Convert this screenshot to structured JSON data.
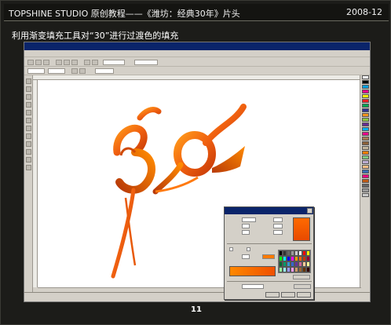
{
  "header": {
    "title": "TOPSHINE STUDIO 原创教程——《潍坊：经典30年》片头",
    "date": "2008-12"
  },
  "caption": "利用渐变填充工具对“30”进行过渡色的填充",
  "page_number": "11",
  "colors": {
    "frame_background": "#1c1c19",
    "gradient_start": "#ff8800",
    "gradient_end": "#e84a00",
    "accent_dark": "#b83a08"
  },
  "icons": [
    "close-icon"
  ]
}
